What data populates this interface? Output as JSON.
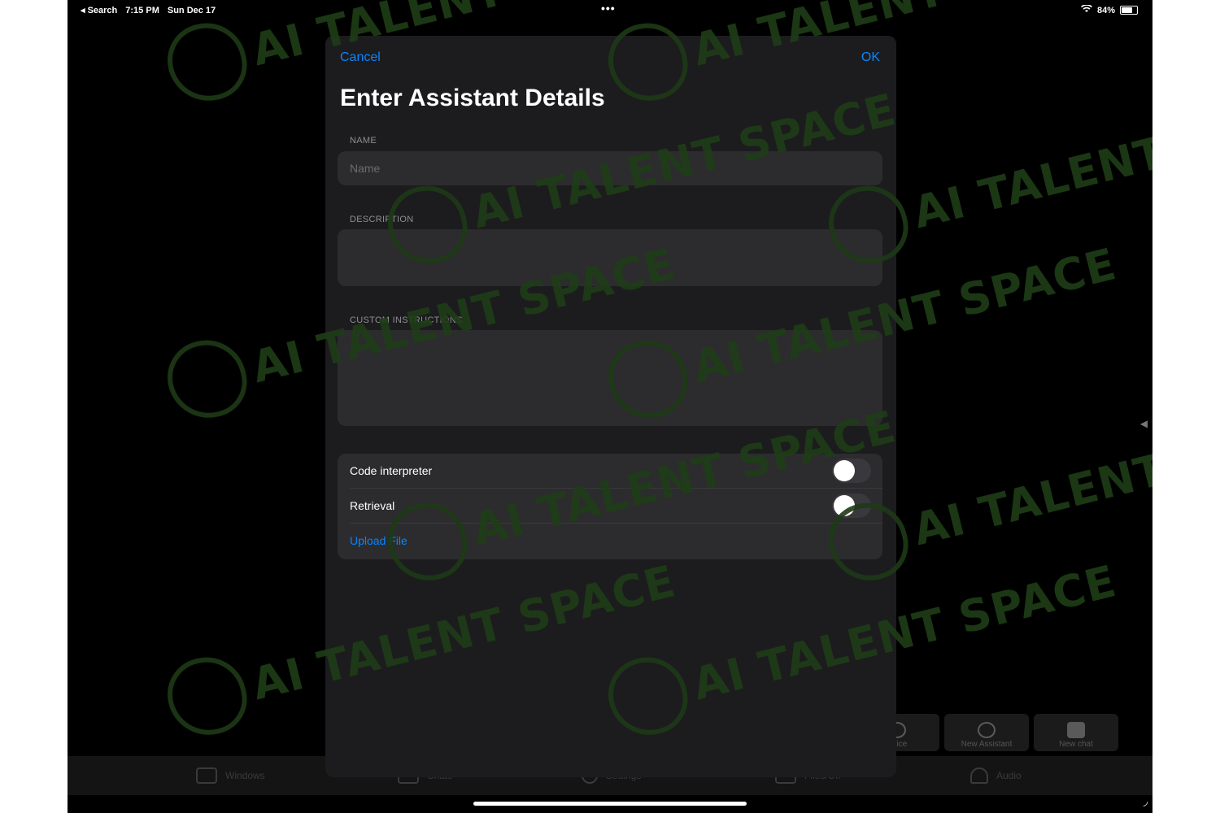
{
  "status_bar": {
    "back_label": "◂ Search",
    "time": "7:15 PM",
    "date": "Sun Dec 17",
    "center_dots": "•••",
    "battery": "84%",
    "battery_level": 0.84
  },
  "watermark": {
    "text": "AI TALENT SPACE"
  },
  "modal": {
    "cancel": "Cancel",
    "ok": "OK",
    "title": "Enter Assistant Details",
    "name_label": "NAME",
    "name_placeholder": "Name",
    "name_value": "",
    "description_label": "DESCRIPTION",
    "description_value": "",
    "instructions_label": "CUSTOM INSTRUCTIONS",
    "instructions_value": "",
    "code_interpreter_label": "Code interpreter",
    "code_interpreter_on": false,
    "retrieval_label": "Retrieval",
    "retrieval_on": false,
    "upload_file": "Upload File"
  },
  "background": {
    "tabs": [
      "Windows",
      "Chats",
      "Settings",
      "Files/Off",
      "Audio"
    ],
    "actions": [
      {
        "label": "Voice",
        "icon": "voice-icon"
      },
      {
        "label": "New Assistant",
        "icon": "assistant-icon"
      },
      {
        "label": "New chat",
        "icon": "chat-icon"
      }
    ]
  },
  "colors": {
    "accent": "#0a84ff",
    "modal_bg": "#1c1c1e",
    "field_bg": "#2c2c2e",
    "watermark": "#1f3d17"
  }
}
